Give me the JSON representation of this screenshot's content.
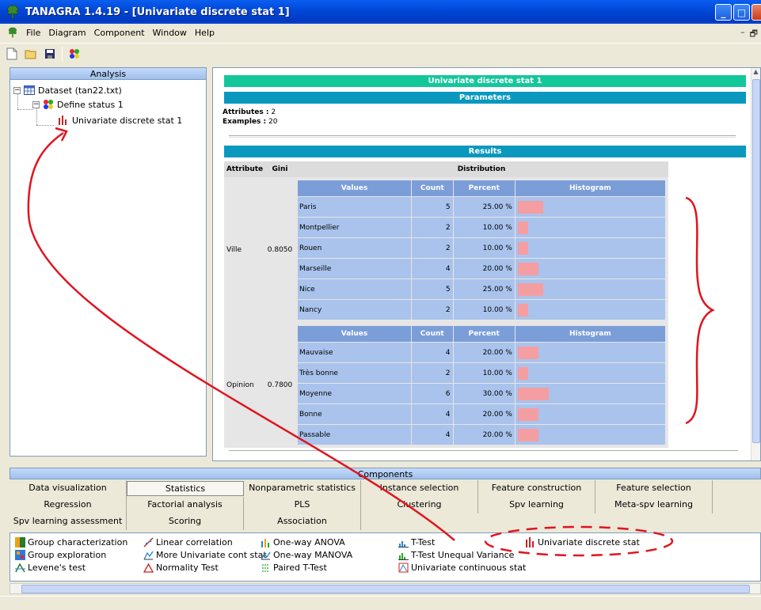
{
  "window": {
    "title": "TANAGRA 1.4.19 - [Univariate discrete stat 1]",
    "buttons": {
      "minimize": "_",
      "maximize": "□",
      "close": "×"
    }
  },
  "menu": {
    "items": [
      "File",
      "Diagram",
      "Component",
      "Window",
      "Help"
    ],
    "mdi_min": "–",
    "mdi_restore": "🗗"
  },
  "analysis": {
    "title": "Analysis",
    "tree": {
      "dataset": "Dataset (tan22.txt)",
      "define_status": "Define status 1",
      "univariate": "Univariate discrete stat 1"
    }
  },
  "result": {
    "title": "Univariate discrete stat 1",
    "parameters_title": "Parameters",
    "attributes_label": "Attributes :",
    "attributes_value": "2",
    "examples_label": "Examples :",
    "examples_value": "20",
    "results_title": "Results",
    "headers": {
      "attribute": "Attribute",
      "gini": "Gini",
      "distribution": "Distribution"
    },
    "sub_headers": {
      "values": "Values",
      "count": "Count",
      "percent": "Percent",
      "histogram": "Histogram"
    },
    "attributes": [
      {
        "name": "Ville",
        "gini": "0.8050",
        "rows": [
          {
            "value": "Paris",
            "count": "5",
            "percent": "25.00 %",
            "pct": 25
          },
          {
            "value": "Montpellier",
            "count": "2",
            "percent": "10.00 %",
            "pct": 10
          },
          {
            "value": "Rouen",
            "count": "2",
            "percent": "10.00 %",
            "pct": 10
          },
          {
            "value": "Marseille",
            "count": "4",
            "percent": "20.00 %",
            "pct": 20
          },
          {
            "value": "Nice",
            "count": "5",
            "percent": "25.00 %",
            "pct": 25
          },
          {
            "value": "Nancy",
            "count": "2",
            "percent": "10.00 %",
            "pct": 10
          }
        ]
      },
      {
        "name": "Opinion",
        "gini": "0.7800",
        "rows": [
          {
            "value": "Mauvaise",
            "count": "4",
            "percent": "20.00 %",
            "pct": 20
          },
          {
            "value": "Très bonne",
            "count": "2",
            "percent": "10.00 %",
            "pct": 10
          },
          {
            "value": "Moyenne",
            "count": "6",
            "percent": "30.00 %",
            "pct": 30
          },
          {
            "value": "Bonne",
            "count": "4",
            "percent": "20.00 %",
            "pct": 20
          },
          {
            "value": "Passable",
            "count": "4",
            "percent": "20.00 %",
            "pct": 20
          }
        ]
      }
    ]
  },
  "components": {
    "title": "Components",
    "tabs": [
      [
        "Data visualization",
        "Statistics",
        "Nonparametric statistics",
        "Instance selection",
        "Feature construction",
        "Feature selection"
      ],
      [
        "Regression",
        "Factorial analysis",
        "PLS",
        "Clustering",
        "Spv learning",
        "Meta-spv learning"
      ],
      [
        "Spv learning assessment",
        "Scoring",
        "Association"
      ]
    ],
    "active_tab": "Statistics",
    "items": [
      [
        "Group characterization",
        "Group exploration",
        "Levene's test"
      ],
      [
        "Linear correlation",
        "More Univariate cont stat",
        "Normality Test"
      ],
      [
        "One-way ANOVA",
        "One-way MANOVA",
        "Paired T-Test"
      ],
      [
        "T-Test",
        "T-Test Unequal Variance",
        "Univariate continuous stat"
      ],
      [
        "Univariate discrete stat"
      ]
    ]
  },
  "colors": {
    "annotation": "#e0141e",
    "histogram_bar": "#f59ea2",
    "band_green": "#14c79a",
    "band_blue": "#0a98bf"
  }
}
